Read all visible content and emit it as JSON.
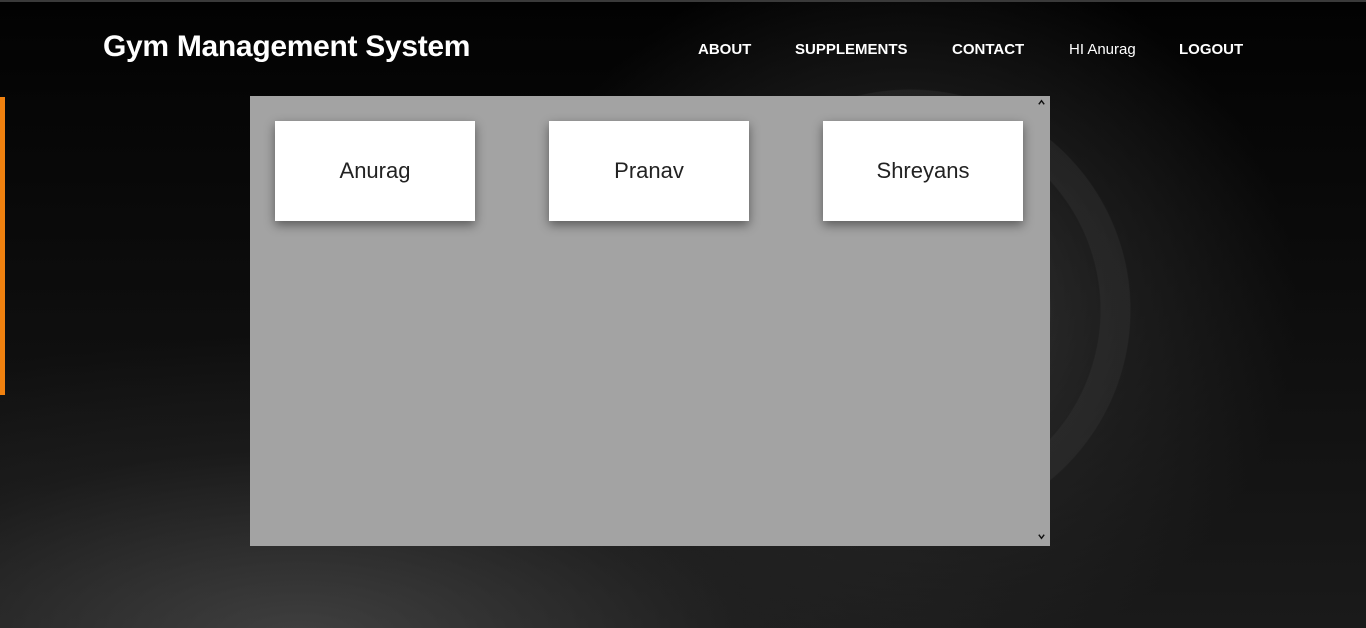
{
  "header": {
    "brand": "Gym Management System",
    "nav": {
      "about": "ABOUT",
      "supplements": "SUPPLEMENTS",
      "contact": "CONTACT",
      "greeting": "HI Anurag",
      "logout": "LOGOUT"
    }
  },
  "members": {
    "cards": [
      "Anurag",
      "Pranav",
      "Shreyans"
    ]
  },
  "scrollbar": {
    "up_icon": "chevron-up-icon",
    "down_icon": "chevron-down-icon"
  },
  "colors": {
    "accent": "#f0810f",
    "panel": "#a3a3a3",
    "card": "#ffffff"
  }
}
